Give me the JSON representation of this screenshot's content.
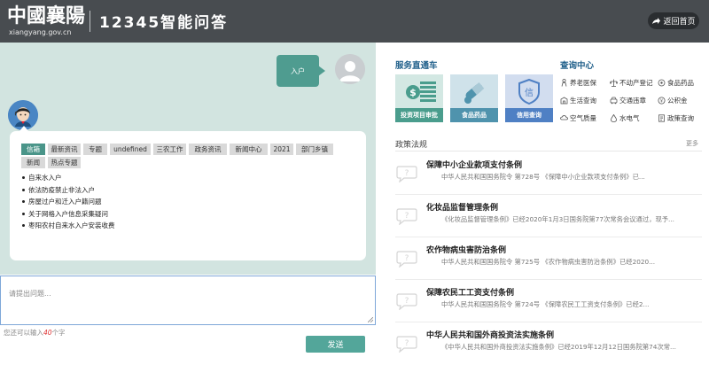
{
  "header": {
    "logo_text": "中國襄陽",
    "logo_url": "xiangyang.gov.cn",
    "title": "12345智能问答",
    "home_button": "返回首页"
  },
  "chat": {
    "user_message": "入户",
    "tabs": [
      "信箱",
      "最新资讯",
      "专题",
      "undefined",
      "三农工作",
      "政务资讯",
      "新闻中心",
      "2021",
      "部门乡镇",
      "新闻",
      "热点专题"
    ],
    "active_tab": "信箱",
    "suggestions": [
      "自来水入户",
      "依法防疫禁止非法入户",
      "房屋过户和迁入户籍问题",
      "关于网格入户信息采集疑问",
      "枣阳农村自来水入户安装收费"
    ]
  },
  "input": {
    "placeholder": "请提出问题...",
    "value": "",
    "counter_prefix": "您还可以输入",
    "counter_num": "40",
    "counter_suffix": "个字",
    "send_label": "发送"
  },
  "services": {
    "title": "服务直通车",
    "cards": [
      {
        "label": "投资项目审批",
        "icon": "money-icon",
        "color": "#4a9d8d"
      },
      {
        "label": "食品药品",
        "icon": "pill-icon",
        "color": "#4f93ad"
      },
      {
        "label": "信用查询",
        "icon": "credit-shield-icon",
        "color": "#4f80c4"
      }
    ]
  },
  "query_center": {
    "title": "查询中心",
    "items": [
      {
        "label": "养老医保",
        "icon": "elderly-icon"
      },
      {
        "label": "不动产登记",
        "icon": "property-icon"
      },
      {
        "label": "食品药品",
        "icon": "food-icon"
      },
      {
        "label": "生活查询",
        "icon": "life-icon"
      },
      {
        "label": "交通违章",
        "icon": "traffic-icon"
      },
      {
        "label": "公积金",
        "icon": "fund-icon"
      },
      {
        "label": "空气质量",
        "icon": "air-icon"
      },
      {
        "label": "水电气",
        "icon": "utility-icon"
      },
      {
        "label": "政策查询",
        "icon": "policy-icon"
      }
    ]
  },
  "policies": {
    "title": "政策法规",
    "more": "更多",
    "items": [
      {
        "title": "保障中小企业款项支付条例",
        "meta": "中华人民共和国国务院令       第728号       《保障中小企业款项支付条例》已..."
      },
      {
        "title": "化妆品监督管理条例",
        "meta": "《化妆品监督管理条例》已经2020年1月3日国务院第77次常务会议通过，现予..."
      },
      {
        "title": "农作物病虫害防治条例",
        "meta": "中华人民共和国国务院令       第725号       《农作物病虫害防治条例》已经2020..."
      },
      {
        "title": "保障农民工工资支付条例",
        "meta": "中华人民共和国国务院令       第724号       《保障农民工工资支付条例》已经2..."
      },
      {
        "title": "中华人民共和国外商投资法实施条例",
        "meta": "《中华人民共和国外商投资法实施条例》已经2019年12月12日国务院第74次常..."
      }
    ]
  }
}
